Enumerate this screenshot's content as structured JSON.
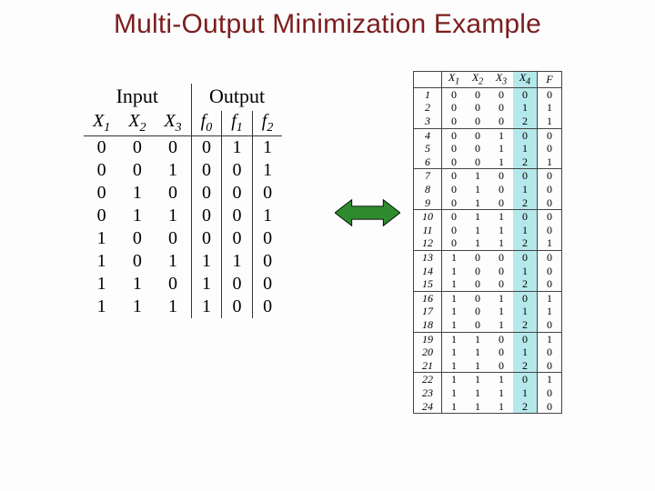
{
  "title": "Multi-Output Minimization Example",
  "left": {
    "group_input": "Input",
    "group_output": "Output",
    "cols": {
      "x1": "X",
      "x1s": "1",
      "x2": "X",
      "x2s": "2",
      "x3": "X",
      "x3s": "3",
      "f0": "f",
      "f0s": "0",
      "f1": "f",
      "f1s": "1",
      "f2": "f",
      "f2s": "2"
    },
    "rows": [
      {
        "x1": "0",
        "x2": "0",
        "x3": "0",
        "f0": "0",
        "f1": "1",
        "f2": "1"
      },
      {
        "x1": "0",
        "x2": "0",
        "x3": "1",
        "f0": "0",
        "f1": "0",
        "f2": "1"
      },
      {
        "x1": "0",
        "x2": "1",
        "x3": "0",
        "f0": "0",
        "f1": "0",
        "f2": "0"
      },
      {
        "x1": "0",
        "x2": "1",
        "x3": "1",
        "f0": "0",
        "f1": "0",
        "f2": "1"
      },
      {
        "x1": "1",
        "x2": "0",
        "x3": "0",
        "f0": "0",
        "f1": "0",
        "f2": "0"
      },
      {
        "x1": "1",
        "x2": "0",
        "x3": "1",
        "f0": "1",
        "f1": "1",
        "f2": "0"
      },
      {
        "x1": "1",
        "x2": "1",
        "x3": "0",
        "f0": "1",
        "f1": "0",
        "f2": "0"
      },
      {
        "x1": "1",
        "x2": "1",
        "x3": "1",
        "f0": "1",
        "f1": "0",
        "f2": "0"
      }
    ]
  },
  "right": {
    "cols": {
      "x1": "X",
      "x1s": "1",
      "x2": "X",
      "x2s": "2",
      "x3": "X",
      "x3s": "3",
      "x4": "X",
      "x4s": "4",
      "f": "F"
    },
    "rows": [
      {
        "i": "1",
        "x1": "0",
        "x2": "0",
        "x3": "0",
        "x4": "0",
        "f": "0"
      },
      {
        "i": "2",
        "x1": "0",
        "x2": "0",
        "x3": "0",
        "x4": "1",
        "f": "1"
      },
      {
        "i": "3",
        "x1": "0",
        "x2": "0",
        "x3": "0",
        "x4": "2",
        "f": "1"
      },
      {
        "i": "4",
        "x1": "0",
        "x2": "0",
        "x3": "1",
        "x4": "0",
        "f": "0"
      },
      {
        "i": "5",
        "x1": "0",
        "x2": "0",
        "x3": "1",
        "x4": "1",
        "f": "0"
      },
      {
        "i": "6",
        "x1": "0",
        "x2": "0",
        "x3": "1",
        "x4": "2",
        "f": "1"
      },
      {
        "i": "7",
        "x1": "0",
        "x2": "1",
        "x3": "0",
        "x4": "0",
        "f": "0"
      },
      {
        "i": "8",
        "x1": "0",
        "x2": "1",
        "x3": "0",
        "x4": "1",
        "f": "0"
      },
      {
        "i": "9",
        "x1": "0",
        "x2": "1",
        "x3": "0",
        "x4": "2",
        "f": "0"
      },
      {
        "i": "10",
        "x1": "0",
        "x2": "1",
        "x3": "1",
        "x4": "0",
        "f": "0"
      },
      {
        "i": "11",
        "x1": "0",
        "x2": "1",
        "x3": "1",
        "x4": "1",
        "f": "0"
      },
      {
        "i": "12",
        "x1": "0",
        "x2": "1",
        "x3": "1",
        "x4": "2",
        "f": "1"
      },
      {
        "i": "13",
        "x1": "1",
        "x2": "0",
        "x3": "0",
        "x4": "0",
        "f": "0"
      },
      {
        "i": "14",
        "x1": "1",
        "x2": "0",
        "x3": "0",
        "x4": "1",
        "f": "0"
      },
      {
        "i": "15",
        "x1": "1",
        "x2": "0",
        "x3": "0",
        "x4": "2",
        "f": "0"
      },
      {
        "i": "16",
        "x1": "1",
        "x2": "0",
        "x3": "1",
        "x4": "0",
        "f": "1"
      },
      {
        "i": "17",
        "x1": "1",
        "x2": "0",
        "x3": "1",
        "x4": "1",
        "f": "1"
      },
      {
        "i": "18",
        "x1": "1",
        "x2": "0",
        "x3": "1",
        "x4": "2",
        "f": "0"
      },
      {
        "i": "19",
        "x1": "1",
        "x2": "1",
        "x3": "0",
        "x4": "0",
        "f": "1"
      },
      {
        "i": "20",
        "x1": "1",
        "x2": "1",
        "x3": "0",
        "x4": "1",
        "f": "0"
      },
      {
        "i": "21",
        "x1": "1",
        "x2": "1",
        "x3": "0",
        "x4": "2",
        "f": "0"
      },
      {
        "i": "22",
        "x1": "1",
        "x2": "1",
        "x3": "1",
        "x4": "0",
        "f": "1"
      },
      {
        "i": "23",
        "x1": "1",
        "x2": "1",
        "x3": "1",
        "x4": "1",
        "f": "0"
      },
      {
        "i": "24",
        "x1": "1",
        "x2": "1",
        "x3": "1",
        "x4": "2",
        "f": "0"
      }
    ],
    "group_ends": [
      3,
      6,
      9,
      12,
      15,
      18,
      21
    ]
  },
  "arrow": {
    "fill": "#2e8b2e",
    "stroke": "#000000"
  }
}
